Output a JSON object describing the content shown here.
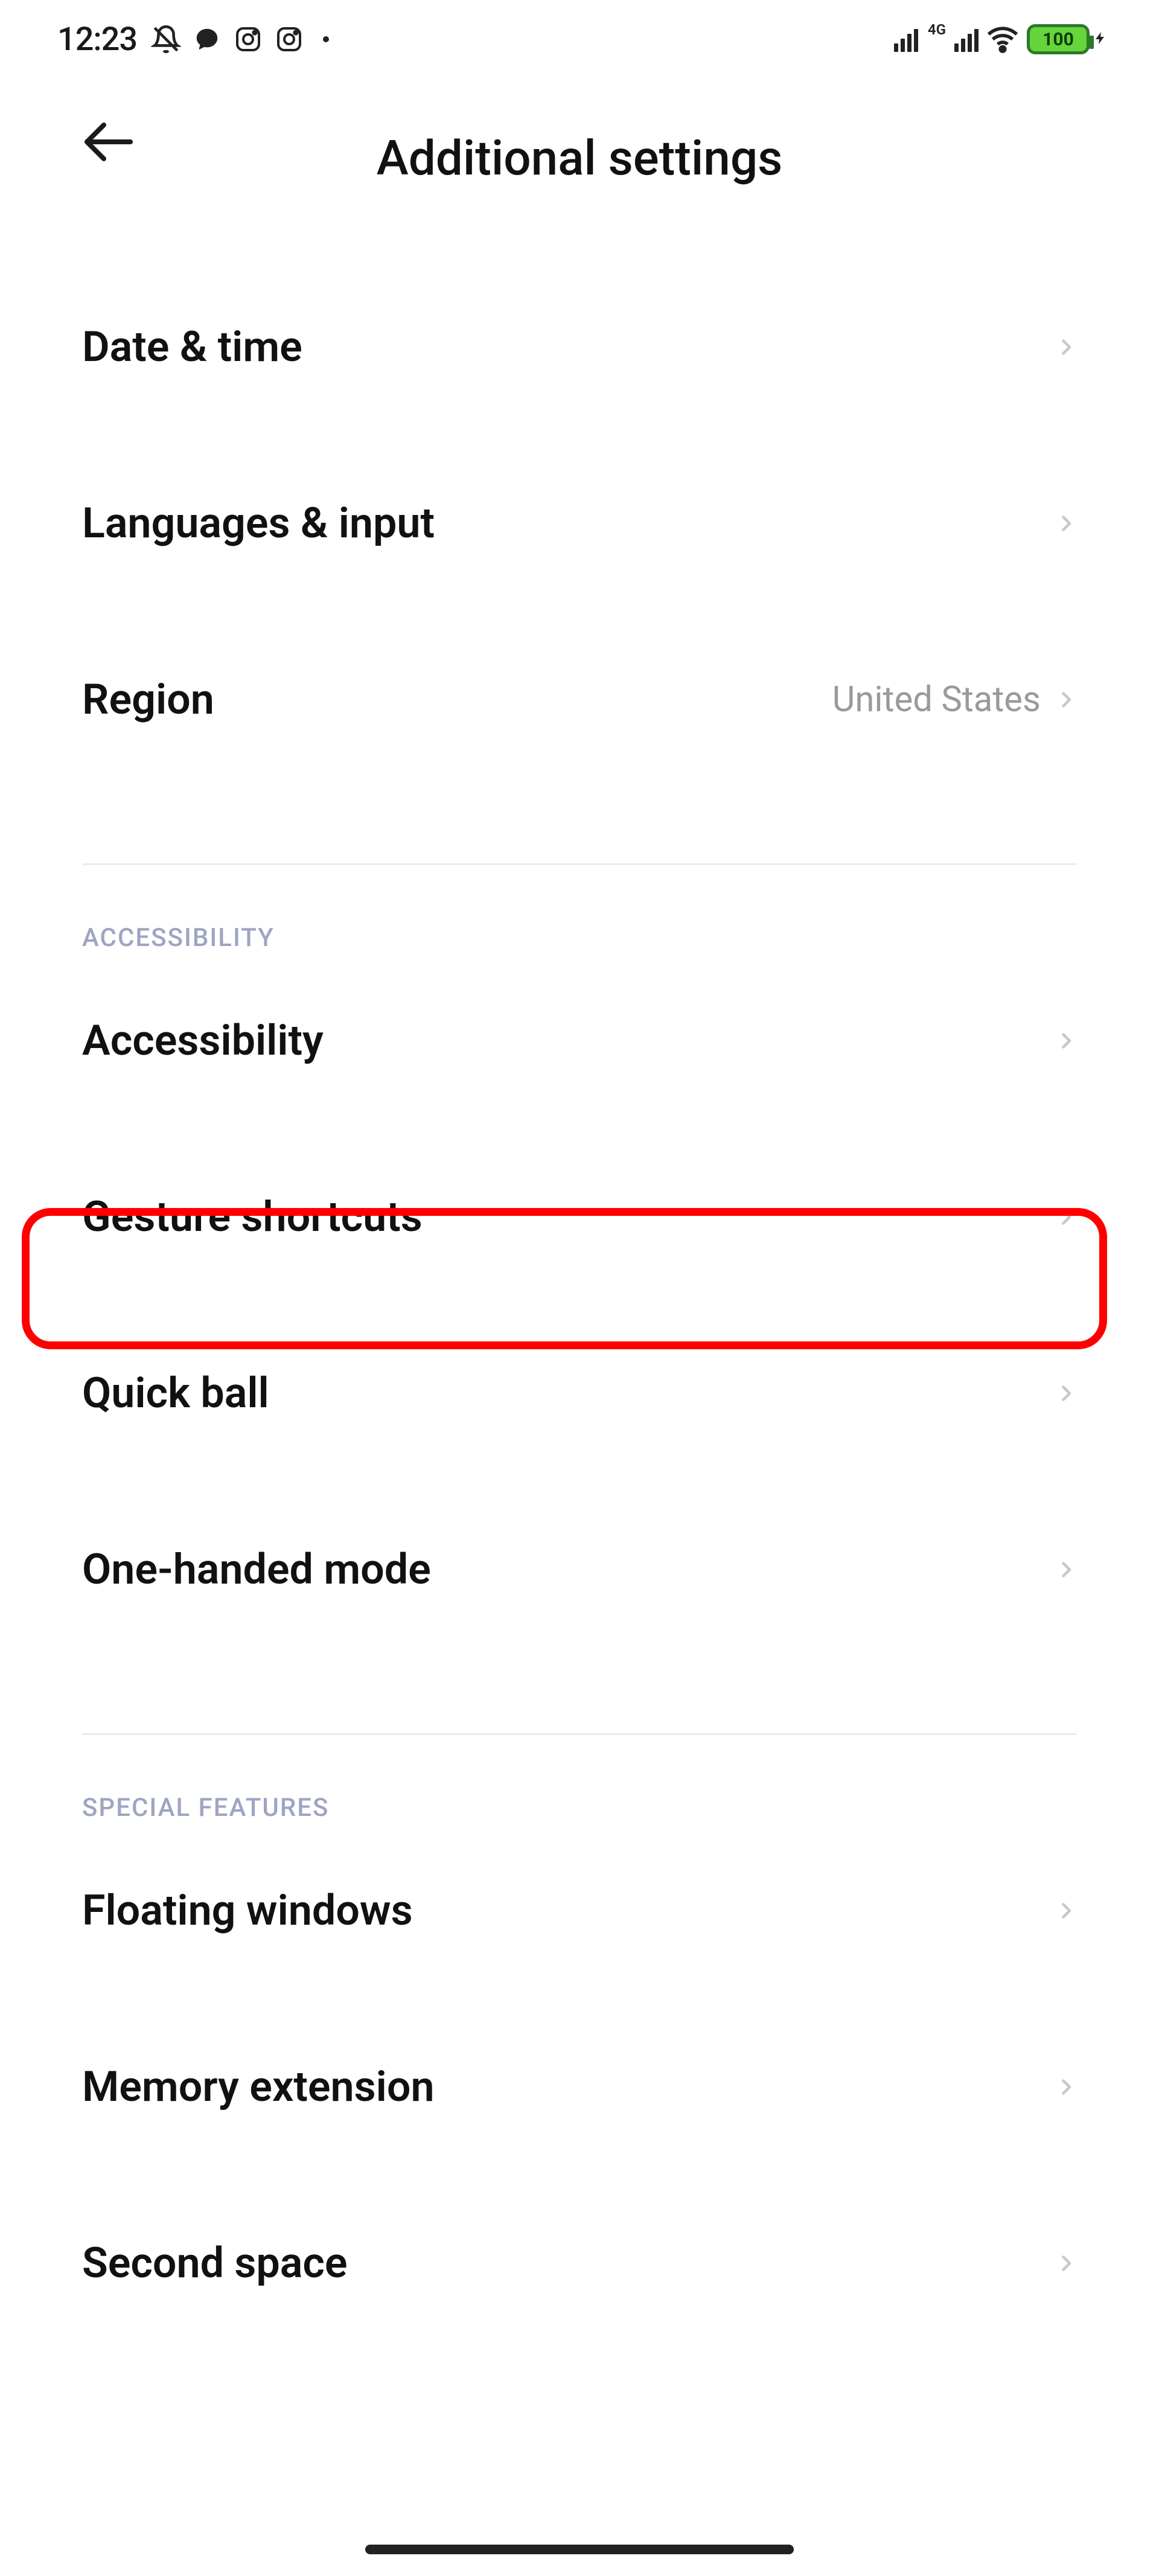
{
  "status": {
    "time": "12:23",
    "network_label": "4G",
    "battery_pct": "100"
  },
  "header": {
    "title": "Additional settings"
  },
  "rows": {
    "date_time": "Date & time",
    "lang_input": "Languages & input",
    "region_label": "Region",
    "region_value": "United States"
  },
  "sections": {
    "accessibility": "ACCESSIBILITY",
    "special": "SPECIAL FEATURES"
  },
  "a11y_rows": {
    "accessibility": "Accessibility",
    "gesture": "Gesture shortcuts",
    "quickball": "Quick ball",
    "onehand": "One-handed mode"
  },
  "special_rows": {
    "floating": "Floating windows",
    "memext": "Memory extension",
    "secondspace": "Second space"
  }
}
